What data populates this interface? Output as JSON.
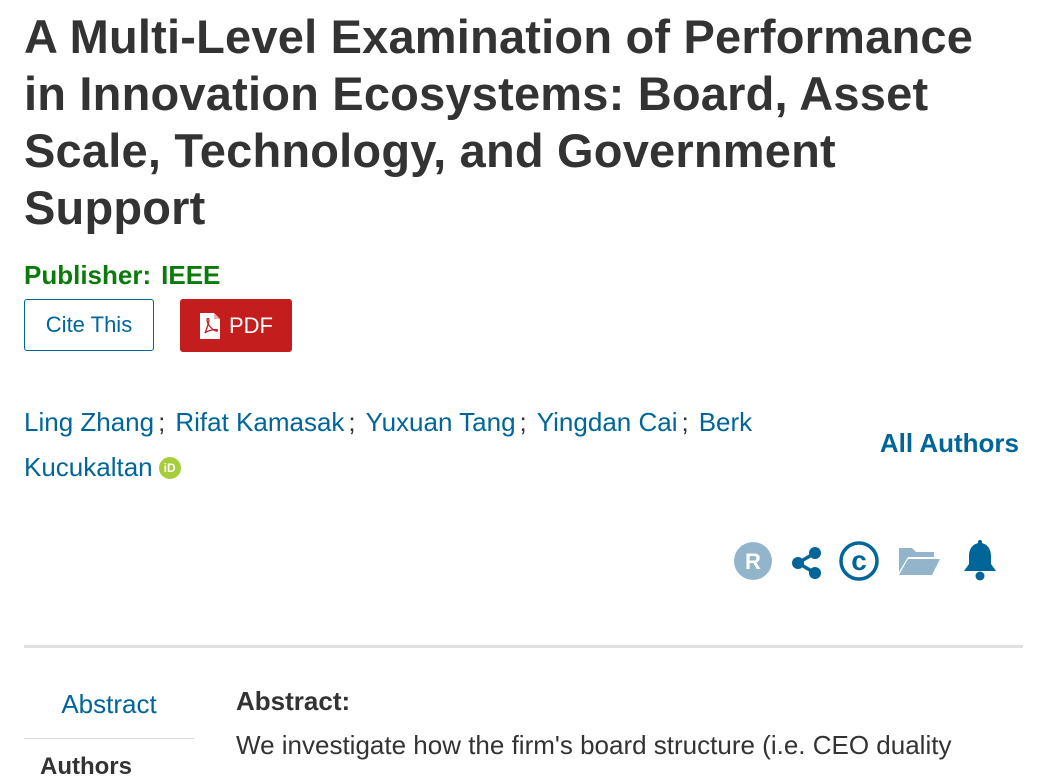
{
  "article": {
    "title": "A Multi-Level Examination of Performance in Innovation Ecosystems: Board, Asset Scale, Technology, and Government Support",
    "publisher_label": "Publisher:",
    "publisher_value": "IEEE"
  },
  "actions": {
    "cite_label": "Cite This",
    "pdf_label": "PDF"
  },
  "authors": {
    "list": [
      "Ling Zhang",
      "Rifat Kamasak",
      "Yuxuan Tang",
      "Yingdan Cai",
      "Berk Kucukaltan"
    ],
    "separator": ";",
    "all_authors_label": "All Authors",
    "orcid_badge": "iD"
  },
  "toolbar": {
    "icons": [
      "rights-link-icon",
      "share-icon",
      "copyright-icon",
      "folder-icon",
      "alert-bell-icon"
    ],
    "r_glyph": "R",
    "c_glyph": "c"
  },
  "nav": {
    "abstract": "Abstract",
    "authors": "Authors"
  },
  "abstract": {
    "heading": "Abstract:",
    "text_first_line": "We investigate how the firm's board structure (i.e. CEO duality"
  },
  "colors": {
    "link": "#006699",
    "publisher": "#0a7a0a",
    "pdf_button": "#c31d1d",
    "orcid": "#a6ce39",
    "rights_icon": "#93b5cc"
  }
}
